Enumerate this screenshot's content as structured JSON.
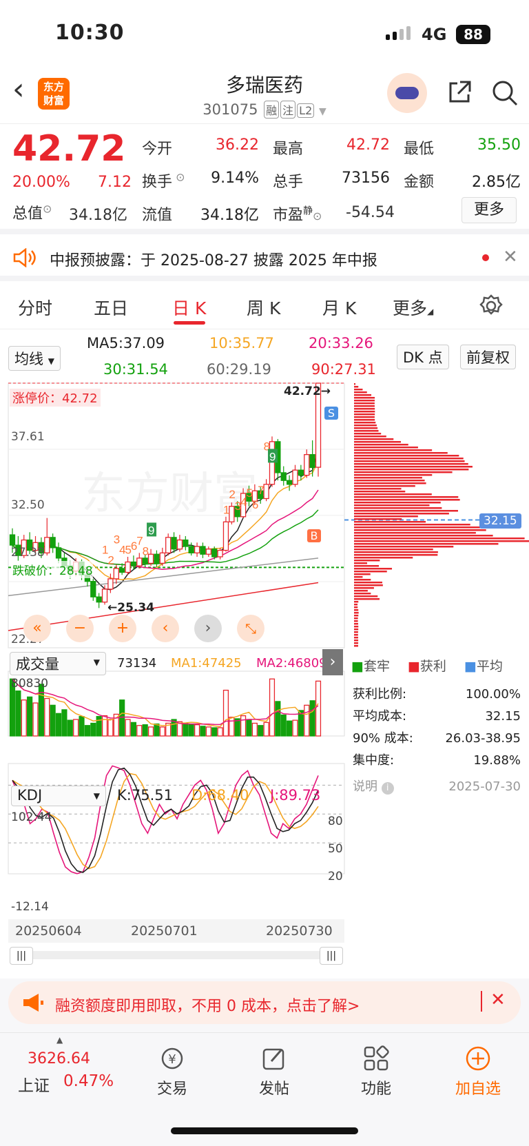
{
  "status": {
    "time": "10:30",
    "network": "4G",
    "battery": "88"
  },
  "header": {
    "logo_line1": "东方",
    "logo_line2": "财富",
    "name": "多瑞医药",
    "code": "301075",
    "tags": [
      "融",
      "注",
      "L2"
    ]
  },
  "quote": {
    "price": "42.72",
    "pct": "20.00%",
    "change": "7.12",
    "open_label": "今开",
    "open": "36.22",
    "high_label": "最高",
    "high": "42.72",
    "low_label": "最低",
    "low": "35.50",
    "turnover_label": "换手",
    "turnover": "9.14%",
    "volume_label": "总手",
    "volume": "73156",
    "amount_label": "金额",
    "amount": "2.85亿",
    "mcap_label": "总值",
    "mcap": "34.18亿",
    "float_label": "流值",
    "float": "34.18亿",
    "pe_label": "市盈",
    "pe_sup": "静",
    "pe": "-54.54",
    "more": "更多"
  },
  "notice": {
    "text": "中报预披露：于 2025-08-27 披露 2025 年中报"
  },
  "tabs": [
    "分时",
    "五日",
    "日 K",
    "周 K",
    "月 K",
    "更多"
  ],
  "ma": {
    "selector": "均线",
    "ma5": "MA5:37.09",
    "ma10": "10:35.77",
    "ma20": "20:33.26",
    "ma30": "30:31.54",
    "ma60": "60:29.19",
    "ma90": "90:27.31",
    "dk": "DK 点",
    "fq": "前复权"
  },
  "kchart": {
    "limit_label": "涨停价：42.72",
    "y_labels": [
      "42.72",
      "37.61",
      "32.50",
      "27.38",
      "22.27"
    ],
    "max_label": "42.72→",
    "min_label": "←25.34",
    "break_label": "跌破价：28.48",
    "cost_label": "32.15",
    "sequence_nums": [
      "1",
      "2",
      "3",
      "4",
      "5",
      "6",
      "7",
      "8",
      "9",
      "1",
      "2",
      "3",
      "4",
      "5",
      "6",
      "7",
      "8",
      "9"
    ],
    "s_label": "S",
    "b_label": "B",
    "watermark": "东方财富"
  },
  "chip": {
    "legend": [
      "套牢",
      "获利",
      "平均"
    ],
    "rows": [
      {
        "k": "获利比例:",
        "v": "100.00%"
      },
      {
        "k": "平均成本:",
        "v": "32.15"
      },
      {
        "k": "90% 成本:",
        "v": "26.03-38.95"
      },
      {
        "k": "集中度:",
        "v": "19.88%"
      }
    ],
    "note": "说明",
    "date": "2025-07-30"
  },
  "volume": {
    "selector": "成交量",
    "vol": "73134",
    "ma1": "MA1:47425",
    "ma2": "MA2:46809",
    "top_label": "80830"
  },
  "kdj": {
    "selector": "KDJ",
    "k": "K:75.51",
    "d": "D:68.40",
    "j": "J:89.73",
    "top": "102.44",
    "bottom": "-12.14",
    "lv80": "80",
    "lv50": "50",
    "lv20": "20"
  },
  "dates": [
    "20250604",
    "20250701",
    "20250730"
  ],
  "promo": {
    "text": "融资额度即用即取，不用 0 成本，点击了解>"
  },
  "bottom": {
    "index_value": "3626.64",
    "index_name": "上证",
    "index_pct": "0.47%",
    "nav": [
      "交易",
      "发帖",
      "功能",
      "加自选"
    ]
  },
  "colors": {
    "up": "#e8262d",
    "down": "#13a10e",
    "accent": "#ff6a00"
  }
}
